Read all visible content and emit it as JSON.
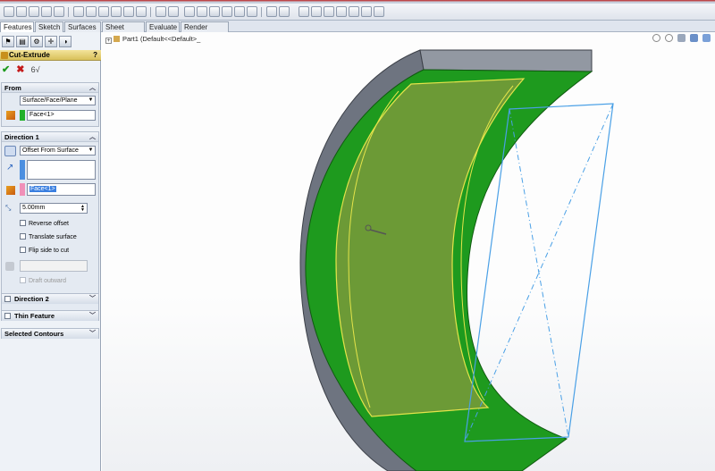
{
  "command_tabs": [
    "Features",
    "Sketch",
    "Surfaces",
    "Sheet Metal",
    "Evaluate",
    "Render Tools"
  ],
  "property_manager": {
    "title": "Cut-Extrude",
    "help": "?",
    "ok_symbol": "✔",
    "cancel_symbol": "✖",
    "detail_symbol": "6√"
  },
  "from": {
    "label": "From",
    "start_condition": "Surface/Face/Plane",
    "face": "Face<1>"
  },
  "direction1": {
    "label": "Direction 1",
    "end_condition": "Offset From Surface",
    "face": "Face<1>",
    "offset": "5.00mm",
    "reverse_offset": "Reverse offset",
    "translate_surface": "Translate surface",
    "flip_side": "Flip side to cut",
    "draft_outward": "Draft outward"
  },
  "direction2": {
    "label": "Direction 2"
  },
  "thin_feature": {
    "label": "Thin Feature"
  },
  "selected_contours": {
    "label": "Selected Contours"
  },
  "tree": {
    "item": "Part1  (Default<<Default>_"
  },
  "colors": {
    "model_gray": "#6e7480",
    "model_green": "#1e9a1e",
    "highlight_yellow": "#e4e44a",
    "sketch_blue": "#4aa0e6",
    "selection_blue": "#3a7fe0"
  }
}
